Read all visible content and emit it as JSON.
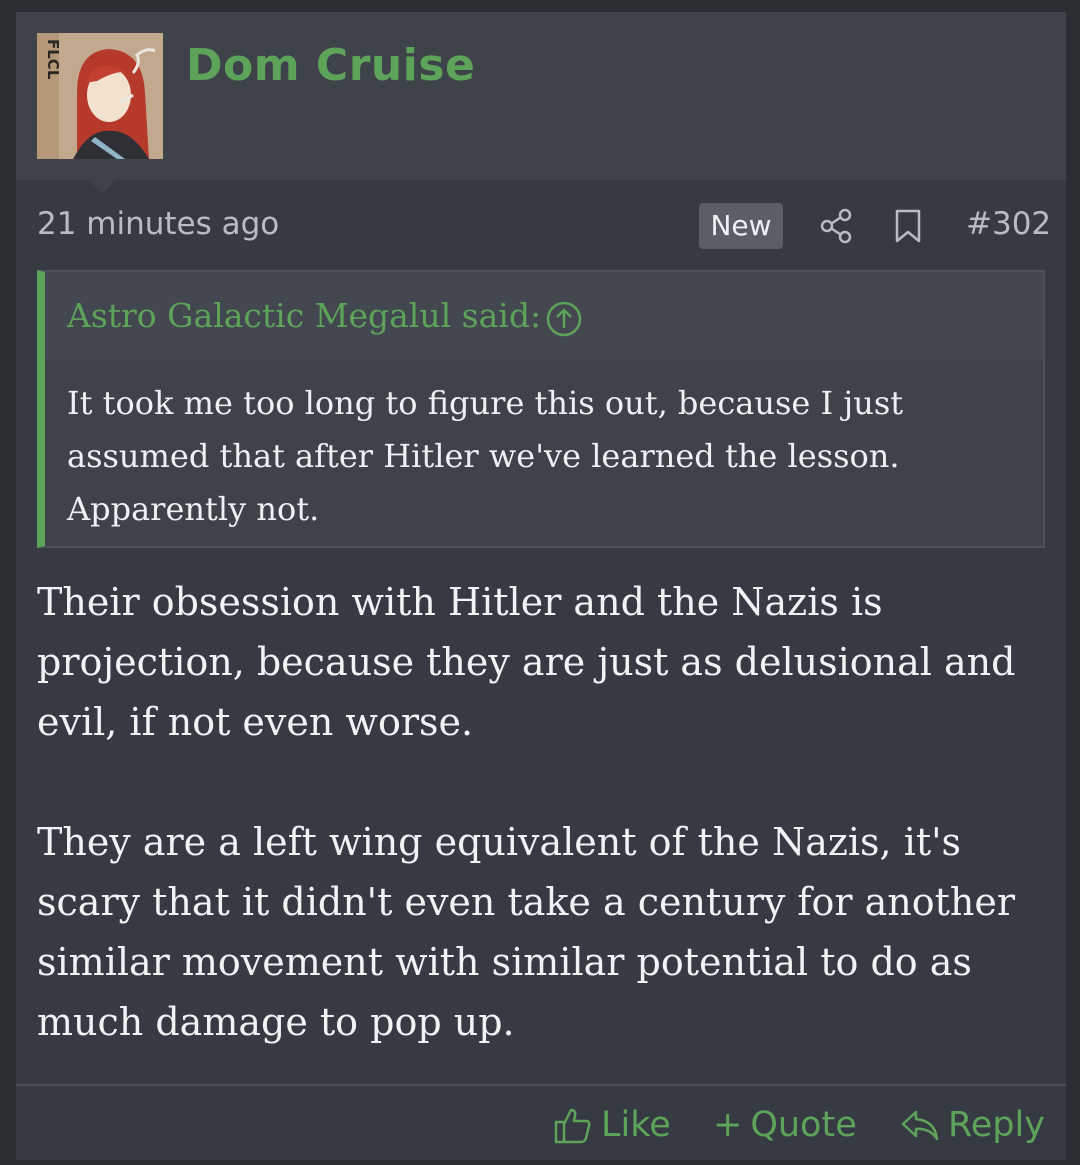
{
  "post": {
    "author": "Dom Cruise",
    "avatar_text": "FLCL",
    "time": "21 minutes ago",
    "badge": "New",
    "number": "#302",
    "quote": {
      "attribution": "Astro Galactic Megalul said:",
      "text": "It took me too long to figure this out, because I just assumed that after Hitler we've learned the lesson. Apparently not."
    },
    "paragraphs": [
      "Their obsession with Hitler and the Nazis is projection, because they are just as delusional and evil, if not even worse.",
      "They are a left wing equivalent of the Nazis, it's scary that it didn't even take a century for another similar movement with similar potential to do as much damage to pop up."
    ],
    "actions": {
      "like": "Like",
      "quote": "Quote",
      "quote_prefix": "+",
      "reply": "Reply"
    }
  },
  "colors": {
    "accent": "#5ea35a",
    "background": "#363a43",
    "header": "#3e4249"
  },
  "icons": [
    "share-icon",
    "bookmark-icon",
    "arrow-up-circle-icon",
    "thumbs-up-icon",
    "reply-icon"
  ]
}
